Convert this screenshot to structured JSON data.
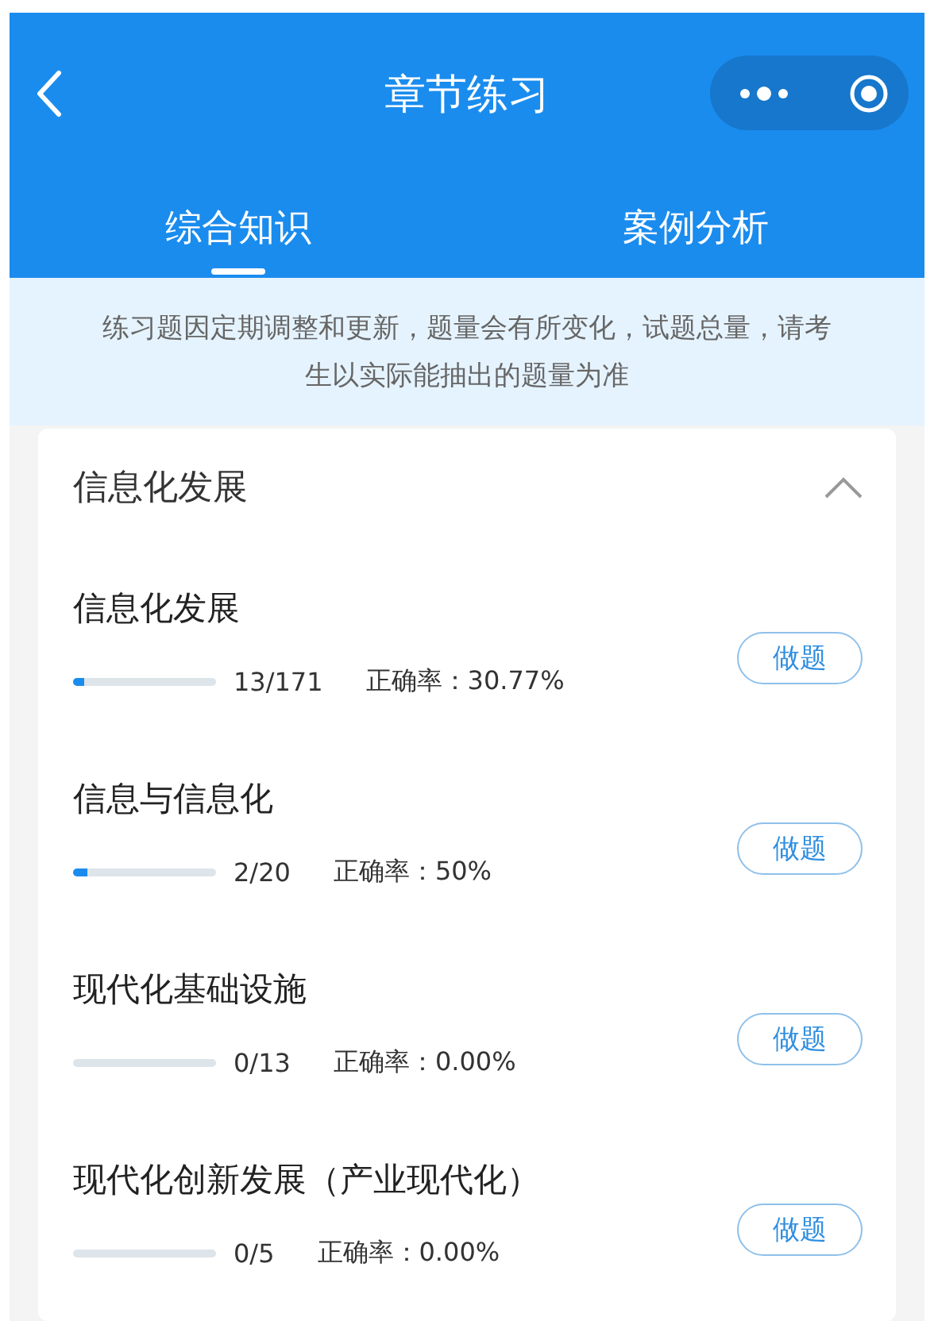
{
  "nav": {
    "title": "章节练习"
  },
  "tabs": [
    {
      "label": "综合知识",
      "selected": true
    },
    {
      "label": "案例分析",
      "selected": false
    }
  ],
  "notice": "练习题因定期调整和更新，题量会有所变化，试题总量，请考生以实际能抽出的题量为准",
  "section": {
    "title": "信息化发展",
    "expanded": true,
    "items": [
      {
        "title": "信息化发展",
        "level": 0.076,
        "count": "13/171",
        "accuracy": "正确率：30.77%",
        "button": "做题"
      },
      {
        "title": "信息与信息化",
        "level": 0.1,
        "count": "2/20",
        "accuracy": "正确率：50%",
        "button": "做题"
      },
      {
        "title": "现代化基础设施",
        "count": "0/13",
        "accuracy": "正确率：0.00%",
        "button": "做题"
      },
      {
        "title": "现代化创新发展（产业现代化）",
        "count": "0/5",
        "accuracy": "正确率：0.00%",
        "button": "做题"
      }
    ]
  }
}
